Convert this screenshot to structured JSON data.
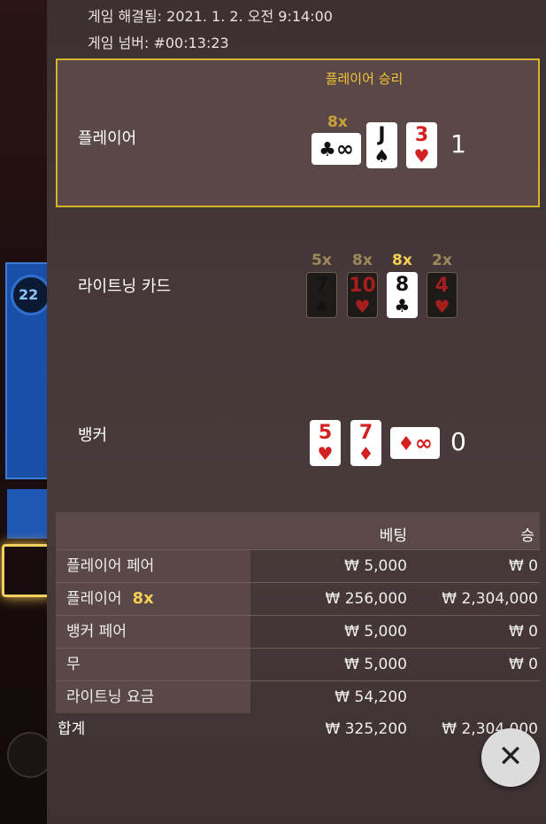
{
  "header": {
    "resolved": "게임 해결됨: 2021. 1. 2. 오전 9:14:00",
    "game_number": "게임 넘버: #00:13:23"
  },
  "background": {
    "timer": "22"
  },
  "player": {
    "label": "플레이어",
    "win_label": "플레이어 승리",
    "multiplier": "8x",
    "cards": [
      {
        "rank": "∞",
        "suit": "♣",
        "color": "black",
        "style": "wide"
      },
      {
        "rank": "J",
        "suit": "♠",
        "color": "black"
      },
      {
        "rank": "3",
        "suit": "♥",
        "color": "red"
      }
    ],
    "score": "1"
  },
  "lightning": {
    "label": "라이트닝 카드",
    "cards": [
      {
        "mult": "5x",
        "rank": "7",
        "suit": "♠",
        "color": "black",
        "style": "dark"
      },
      {
        "mult": "8x",
        "rank": "10",
        "suit": "♥",
        "color": "red",
        "style": "dark"
      },
      {
        "mult": "8x",
        "rank": "8",
        "suit": "♣",
        "color": "black",
        "style": "light"
      },
      {
        "mult": "2x",
        "rank": "4",
        "suit": "♥",
        "color": "red",
        "style": "dark"
      }
    ]
  },
  "banker": {
    "label": "뱅커",
    "cards": [
      {
        "rank": "5",
        "suit": "♥",
        "color": "red"
      },
      {
        "rank": "7",
        "suit": "♦",
        "color": "red"
      },
      {
        "rank": "∞",
        "suit": "♦",
        "color": "red",
        "style": "wide"
      }
    ],
    "score": "0"
  },
  "table": {
    "col_bet": "베팅",
    "col_win": "승",
    "rows": [
      {
        "label": "플레이어 페어",
        "bet": "₩ 5,000",
        "win": "₩ 0"
      },
      {
        "label": "플레이어",
        "badge": "8x",
        "bet": "₩ 256,000",
        "win": "₩ 2,304,000"
      },
      {
        "label": "뱅커 페어",
        "bet": "₩ 5,000",
        "win": "₩ 0"
      },
      {
        "label": "무",
        "bet": "₩ 5,000",
        "win": "₩ 0"
      },
      {
        "label": "라이트닝 요금",
        "bet": "₩ 54,200",
        "win": ""
      }
    ],
    "total": {
      "label": "합계",
      "bet": "₩ 325,200",
      "win": "₩ 2,304,000"
    }
  },
  "close_icon": "close-icon"
}
